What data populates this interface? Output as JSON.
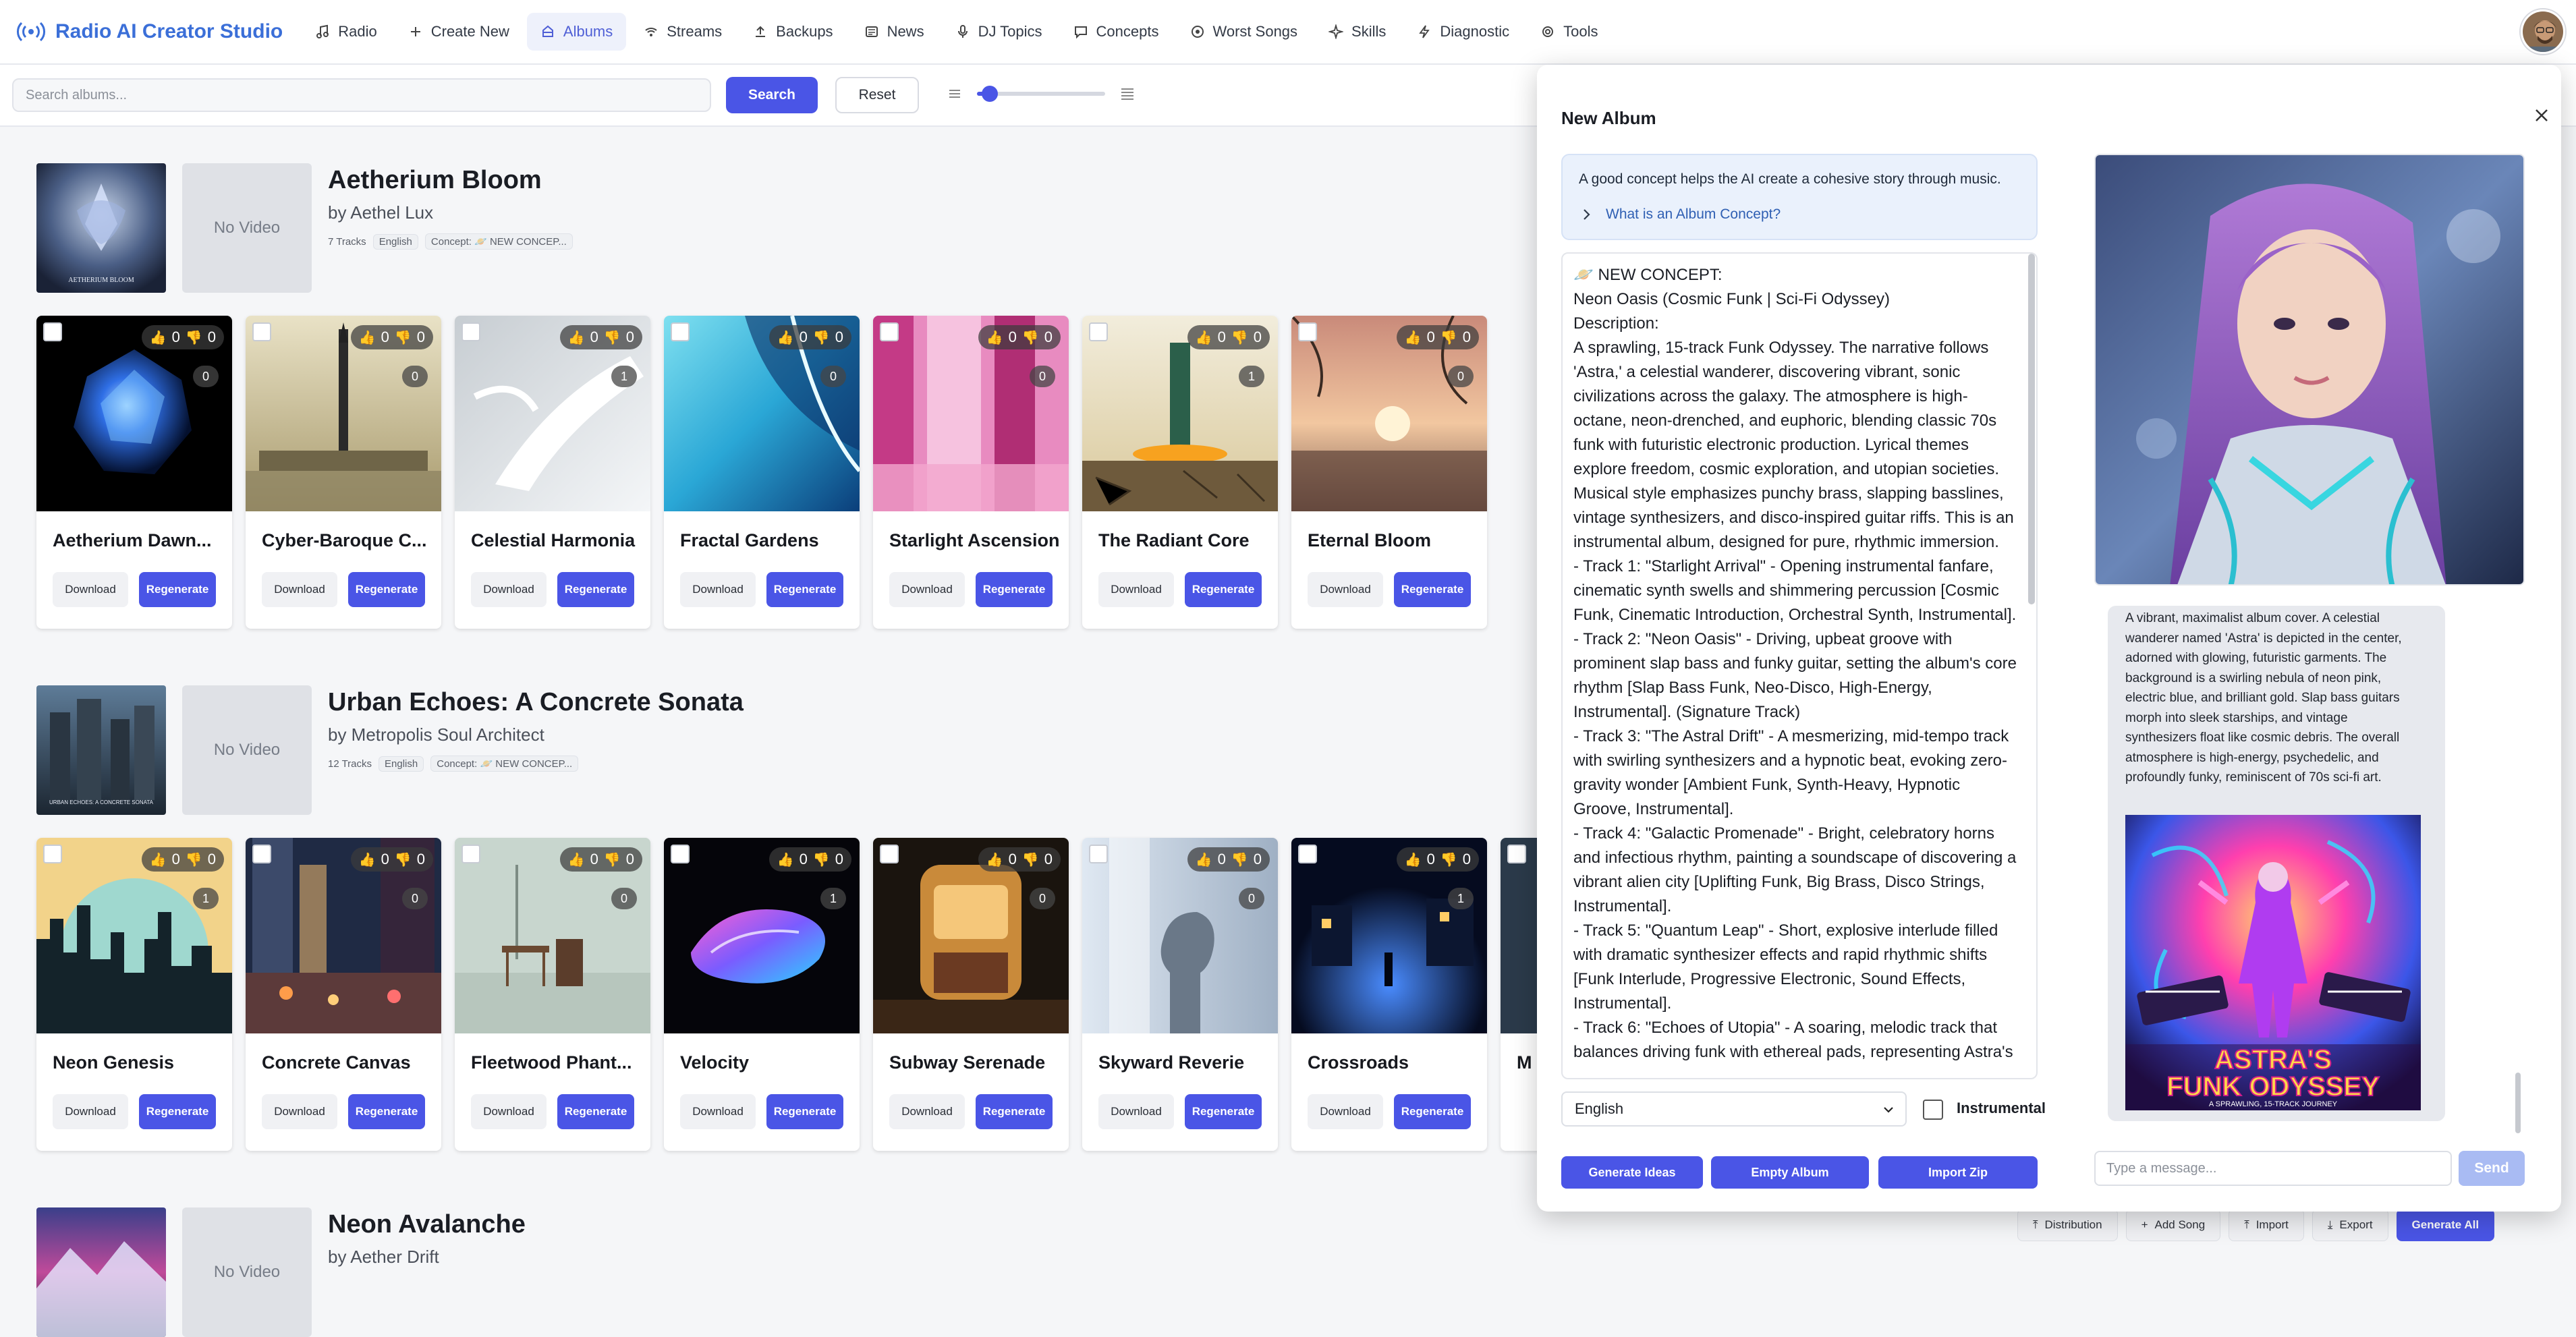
{
  "app": {
    "title": "Radio AI Creator Studio"
  },
  "nav": [
    {
      "label": "Radio",
      "icon": "music-note-icon"
    },
    {
      "label": "Create New",
      "icon": "plus-icon"
    },
    {
      "label": "Albums",
      "icon": "album-icon",
      "active": true
    },
    {
      "label": "Streams",
      "icon": "broadcast-icon"
    },
    {
      "label": "Backups",
      "icon": "upload-icon"
    },
    {
      "label": "News",
      "icon": "newspaper-icon"
    },
    {
      "label": "DJ Topics",
      "icon": "microphone-icon"
    },
    {
      "label": "Concepts",
      "icon": "chat-icon"
    },
    {
      "label": "Worst Songs",
      "icon": "target-icon"
    },
    {
      "label": "Skills",
      "icon": "sparkle-icon"
    },
    {
      "label": "Diagnostic",
      "icon": "pulse-icon"
    },
    {
      "label": "Tools",
      "icon": "gear-icon"
    }
  ],
  "toolbar": {
    "search_placeholder": "Search albums...",
    "search_label": "Search",
    "reset_label": "Reset",
    "zoom_level": 0.1
  },
  "albums": [
    {
      "title": "Aetherium Bloom",
      "artist": "by Aethel Lux",
      "tracks_count": "7 Tracks",
      "language": "English",
      "concept": "Concept: 🪐 NEW CONCEP...",
      "no_video": "No Video",
      "tracks": [
        {
          "title": "Aetherium Dawn...",
          "up": "0",
          "down": "0",
          "plays": "0"
        },
        {
          "title": "Cyber-Baroque C...",
          "up": "0",
          "down": "0",
          "plays": "0"
        },
        {
          "title": "Celestial Harmonia",
          "up": "0",
          "down": "0",
          "plays": "1"
        },
        {
          "title": "Fractal Gardens",
          "up": "0",
          "down": "0",
          "plays": "0"
        },
        {
          "title": "Starlight Ascension",
          "up": "0",
          "down": "0",
          "plays": "0"
        },
        {
          "title": "The Radiant Core",
          "up": "0",
          "down": "0",
          "plays": "1"
        },
        {
          "title": "Eternal Bloom",
          "up": "0",
          "down": "0",
          "plays": "0"
        }
      ]
    },
    {
      "title": "Urban Echoes: A Concrete Sonata",
      "artist": "by Metropolis Soul Architect",
      "tracks_count": "12 Tracks",
      "language": "English",
      "concept": "Concept: 🪐 NEW CONCEP...",
      "no_video": "No Video",
      "tracks": [
        {
          "title": "Neon Genesis",
          "up": "0",
          "down": "0",
          "plays": "1"
        },
        {
          "title": "Concrete Canvas",
          "up": "0",
          "down": "0",
          "plays": "0"
        },
        {
          "title": "Fleetwood Phant...",
          "up": "0",
          "down": "0",
          "plays": "0"
        },
        {
          "title": "Velocity",
          "up": "0",
          "down": "0",
          "plays": "1"
        },
        {
          "title": "Subway Serenade",
          "up": "0",
          "down": "0",
          "plays": "0"
        },
        {
          "title": "Skyward Reverie",
          "up": "0",
          "down": "0",
          "plays": "0"
        },
        {
          "title": "Crossroads",
          "up": "0",
          "down": "0",
          "plays": "1"
        },
        {
          "title": "M",
          "up": "",
          "down": "",
          "plays": ""
        }
      ]
    },
    {
      "title": "Neon Avalanche",
      "artist": "by Aether Drift",
      "no_video": "No Video"
    }
  ],
  "track_buttons": {
    "download": "Download",
    "regenerate": "Regenerate"
  },
  "bottom_bar": [
    {
      "label": "Distribution",
      "icon": "upload-icon"
    },
    {
      "label": "Add Song",
      "icon": "plus-icon"
    },
    {
      "label": "Import",
      "icon": "upload-icon"
    },
    {
      "label": "Export",
      "icon": "download-icon"
    },
    {
      "label": "Generate All",
      "primary": true
    }
  ],
  "modal": {
    "title": "New Album",
    "info_text": "A good concept helps the AI create a cohesive story through music.",
    "info_link": "What is an Album Concept?",
    "concept_text": "🪐 NEW CONCEPT:\nNeon Oasis (Cosmic Funk | Sci-Fi Odyssey)\nDescription:\nA sprawling, 15-track Funk Odyssey. The narrative follows 'Astra,' a celestial wanderer, discovering vibrant, sonic civilizations across the galaxy. The atmosphere is high-octane, neon-drenched, and euphoric, blending classic 70s funk with futuristic electronic production. Lyrical themes explore freedom, cosmic exploration, and utopian societies. Musical style emphasizes punchy brass, slapping basslines, vintage synthesizers, and disco-inspired guitar riffs. This is an instrumental album, designed for pure, rhythmic immersion.\n- Track 1: \"Starlight Arrival\" - Opening instrumental fanfare, cinematic synth swells and shimmering percussion [Cosmic Funk, Cinematic Introduction, Orchestral Synth, Instrumental].\n- Track 2: \"Neon Oasis\" - Driving, upbeat groove with prominent slap bass and funky guitar, setting the album's core rhythm [Slap Bass Funk, Neo-Disco, High-Energy, Instrumental]. (Signature Track)\n- Track 3: \"The Astral Drift\" - A mesmerizing, mid-tempo track with swirling synthesizers and a hypnotic beat, evoking zero-gravity wonder [Ambient Funk, Synth-Heavy, Hypnotic Groove, Instrumental].\n- Track 4: \"Galactic Promenade\" - Bright, celebratory horns and infectious rhythm, painting a soundscape of discovering a vibrant alien city [Uplifting Funk, Big Brass, Disco Strings, Instrumental].\n- Track 5: \"Quantum Leap\" - Short, explosive interlude filled with dramatic synthesizer effects and rapid rhythmic shifts [Funk Interlude, Progressive Electronic, Sound Effects, Instrumental].\n- Track 6: \"Echoes of Utopia\" - A soaring, melodic track that balances driving funk with ethereal pads, representing Astra's",
    "language": "English",
    "instrumental_label": "Instrumental",
    "buttons": {
      "generate": "Generate Ideas",
      "empty": "Empty Album",
      "import": "Import Zip"
    },
    "chat_text": "A vibrant, maximalist album cover. A celestial wanderer named 'Astra' is depicted in the center, adorned with glowing, futuristic garments. The background is a swirling nebula of neon pink, electric blue, and brilliant gold. Slap bass guitars morph into sleek starships, and vintage synthesizers float like cosmic debris. The overall atmosphere is high-energy, psychedelic, and profoundly funky, reminiscent of 70s sci-fi art.",
    "cover_title_line1": "ASTRA'S",
    "cover_title_line2": "FUNK ODYSSEY",
    "cover_subtitle": "A SPRAWLING, 15-TRACK JOURNEY",
    "chat_placeholder": "Type a message...",
    "send_label": "Send"
  },
  "colors": {
    "accent": "#4a55e6",
    "brand": "#3b6fd8",
    "up_vote": "#3ecf6a",
    "down_vote": "#ef4343"
  }
}
